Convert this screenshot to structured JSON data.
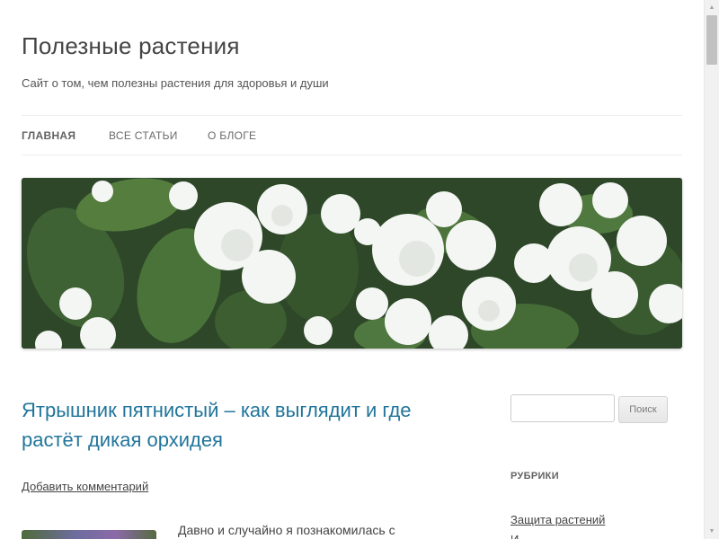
{
  "site": {
    "title": "Полезные растения",
    "description": "Сайт о том, чем полезны растения для здоровья и души"
  },
  "nav": {
    "items": [
      {
        "label": "ГЛАВНАЯ",
        "current": true
      },
      {
        "label": "ВСЕ СТАТЬИ",
        "current": false
      },
      {
        "label": "О БЛОГЕ",
        "current": false
      }
    ]
  },
  "banner": {
    "subject": "white jasmine flowers with green leaves"
  },
  "post": {
    "title": "Ятрышник пятнистый – как выглядит и где растёт дикая орхидея",
    "comments_link": "Добавить комментарий",
    "excerpt": "Давно и случайно я познакомилась с"
  },
  "sidebar": {
    "search": {
      "placeholder": "",
      "button_label": "Поиск"
    },
    "categories": {
      "title": "РУБРИКИ",
      "items": [
        "Защита растений",
        "И"
      ]
    }
  },
  "colors": {
    "link": "#21759b",
    "text": "#444444",
    "border": "#ededed"
  }
}
